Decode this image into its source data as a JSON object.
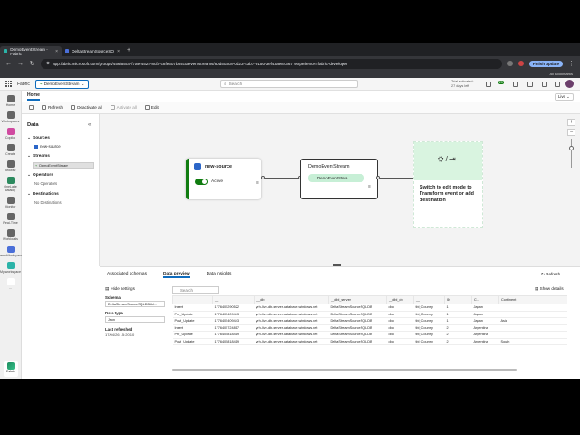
{
  "browser": {
    "tabs": [
      {
        "label": "DemoEventStream - Fabric",
        "active": true
      },
      {
        "label": "DeltaStreamSourceSQLDB",
        "active": false
      }
    ],
    "url": "app.fabric.microsoft.com/groups/456f55c5-f7ae-4524-8cfa-c8fe307b84c0/eventstreams/80d503c8-0d23-43b7-9150-3ef43ae84367?experience=fabric-developer",
    "finish_update_label": "Finish update",
    "bookmarks_label": "All Bookmarks"
  },
  "header": {
    "app_name": "Fabric",
    "item_name": "DemoEventStream",
    "search_placeholder": "Search",
    "trial_line1": "Trial activated:",
    "trial_line2": "27 days left",
    "notification_count": "25"
  },
  "rail": [
    {
      "label": "Home",
      "color": "#666"
    },
    {
      "label": "Workspaces",
      "color": "#666"
    },
    {
      "label": "Copilot",
      "color": "#d04aa0"
    },
    {
      "label": "Create",
      "color": "#666"
    },
    {
      "label": "Browse",
      "color": "#666"
    },
    {
      "label": "OneLake catalog",
      "color": "#2d8a5f"
    },
    {
      "label": "Monitor",
      "color": "#666"
    },
    {
      "label": "Real-Time",
      "color": "#666"
    },
    {
      "label": "Workloads",
      "color": "#666"
    },
    {
      "label": "DemoWorkspace",
      "color": "#4b6fd8"
    },
    {
      "label": "My workspace",
      "color": "#2bb3a8"
    },
    {
      "label": "...",
      "color": "#ffffff"
    }
  ],
  "rail_bottom_label": "Fabric",
  "ribbon": {
    "home_tab": "Home",
    "live_label": "Live",
    "buttons": [
      {
        "label": "Refresh",
        "disabled": false
      },
      {
        "label": "Deactivate all",
        "disabled": false
      },
      {
        "label": "Activate all",
        "disabled": true
      },
      {
        "label": "Edit",
        "disabled": false
      }
    ]
  },
  "data_panel": {
    "title": "Data",
    "sources_label": "Sources",
    "source_item": "new-source",
    "streams_label": "Streams",
    "stream_item": "DemoEventStream",
    "operators_label": "Operators",
    "operators_empty": "No Operators",
    "destinations_label": "Destinations",
    "destinations_empty": "No Destinations"
  },
  "canvas": {
    "source_name": "new-source",
    "source_status": "Active",
    "stream_name": "DemoEventStream",
    "stream_pill": "DemoEventStrea...",
    "dest_text": "Switch to edit mode to Transform event or add destination"
  },
  "bottom": {
    "tabs": [
      "Associated schemas",
      "Data preview",
      "Data insights"
    ],
    "active_tab": 1,
    "refresh_label": "Refresh",
    "hide_settings_label": "Hide settings",
    "show_details_label": "Show details",
    "search_placeholder": "Search",
    "schema_label": "Schema",
    "schema_value": "DeltaStreamSourceSQLDB.tbl...",
    "datatype_label": "Data type",
    "datatype_value": "Json",
    "last_refreshed_label": "Last refreshed",
    "last_refreshed_value": "17/04/26 15:20:10"
  },
  "table": {
    "columns": [
      "__",
      "__db",
      "__dbl_server",
      "__dbl_db",
      "__",
      "ID",
      "C...",
      "Continent"
    ],
    "rows": [
      [
        "Insert",
        "1776405290522",
        "yrh-live-db-server.database.windows.net",
        "DeltaStreamSourceSQLDB",
        "dbo",
        "tbl_Country",
        "1",
        "Japan",
        ""
      ],
      [
        "Pre_Update",
        "1776405409443",
        "yrh-live-db-server.database.windows.net",
        "DeltaStreamSourceSQLDB",
        "dbo",
        "tbl_Country",
        "1",
        "Japan",
        ""
      ],
      [
        "Post_Update",
        "1776405409443",
        "yrh-live-db-server.database.windows.net",
        "DeltaStreamSourceSQLDB",
        "dbo",
        "tbl_Country",
        "1",
        "Japan",
        "Asia"
      ],
      [
        "Insert",
        "1776405724817",
        "yrh-live-db-server.database.windows.net",
        "DeltaStreamSourceSQLDB",
        "dbo",
        "tbl_Country",
        "2",
        "Argentina",
        ""
      ],
      [
        "Pre_Update",
        "1776405818419",
        "yrh-live-db-server.database.windows.net",
        "DeltaStreamSourceSQLDB",
        "dbo",
        "tbl_Country",
        "2",
        "Argentina",
        ""
      ],
      [
        "Post_Update",
        "1776405818419",
        "yrh-live-db-server.database.windows.net",
        "DeltaStreamSourceSQLDB",
        "dbo",
        "tbl_Country",
        "2",
        "Argentina",
        "South"
      ]
    ]
  }
}
